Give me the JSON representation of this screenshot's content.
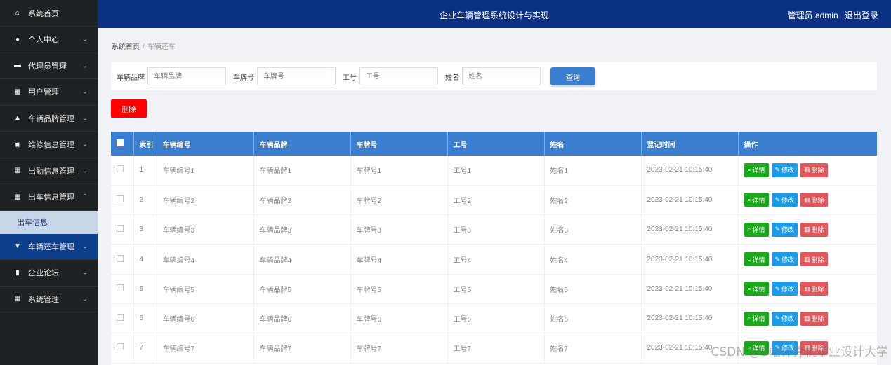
{
  "sidebar": {
    "items": [
      {
        "icon": "home-icon",
        "glyph": "⌂",
        "label": "系统首页",
        "chevron": ""
      },
      {
        "icon": "user-icon",
        "glyph": "●",
        "label": "个人中心",
        "chevron": "⌄"
      },
      {
        "icon": "monitor-icon",
        "glyph": "▬",
        "label": "代理员管理",
        "chevron": "⌄"
      },
      {
        "icon": "grid-icon",
        "glyph": "▦",
        "label": "用户管理",
        "chevron": "⌄"
      },
      {
        "icon": "car-icon",
        "glyph": "▲",
        "label": "车辆品牌管理",
        "chevron": "⌄"
      },
      {
        "icon": "clipboard-icon",
        "glyph": "▣",
        "label": "维修信息管理",
        "chevron": "⌄"
      },
      {
        "icon": "grid-icon",
        "glyph": "▦",
        "label": "出勤信息管理",
        "chevron": "⌄"
      },
      {
        "icon": "grid-icon",
        "glyph": "▦",
        "label": "出车信息管理",
        "chevron": "⌃"
      }
    ],
    "sub_item": "出车信息",
    "active_item": {
      "icon": "flag-icon",
      "glyph": "▼",
      "label": "车辆还车管理",
      "chevron": "⌄"
    },
    "after_items": [
      {
        "icon": "bar-chart-icon",
        "glyph": "▮",
        "label": "企业论坛",
        "chevron": "⌄"
      },
      {
        "icon": "grid-icon",
        "glyph": "▦",
        "label": "系统管理",
        "chevron": "⌄"
      }
    ]
  },
  "header": {
    "title": "企业车辆管理系统设计与实现",
    "user_prefix": "管理员 admin",
    "logout": "退出登录"
  },
  "breadcrumb": {
    "home": "系统首页",
    "sep": "/",
    "current": "车辆还车"
  },
  "filter": {
    "brand_label": "车辆品牌",
    "brand_placeholder": "车辆品牌",
    "plate_label": "车牌号",
    "plate_placeholder": "车牌号",
    "staff_label": "工号",
    "staff_placeholder": "工号",
    "name_label": "姓名",
    "name_placeholder": "姓名",
    "search_label": "查询"
  },
  "delete_label": "删除",
  "table": {
    "headers": [
      "索引",
      "车辆编号",
      "车辆品牌",
      "车牌号",
      "工号",
      "姓名",
      "登记时间",
      "操作"
    ],
    "rows": [
      {
        "index": "1",
        "code": "车辆编号1",
        "brand": "车辆品牌1",
        "plate": "车牌号1",
        "staff": "工号1",
        "name": "姓名1",
        "time": "2023-02-21 10:15:40"
      },
      {
        "index": "2",
        "code": "车辆编号2",
        "brand": "车辆品牌2",
        "plate": "车牌号2",
        "staff": "工号2",
        "name": "姓名2",
        "time": "2023-02-21 10:15:40"
      },
      {
        "index": "3",
        "code": "车辆编号3",
        "brand": "车辆品牌3",
        "plate": "车牌号3",
        "staff": "工号3",
        "name": "姓名3",
        "time": "2023-02-21 10:15:40"
      },
      {
        "index": "4",
        "code": "车辆编号4",
        "brand": "车辆品牌4",
        "plate": "车牌号4",
        "staff": "工号4",
        "name": "姓名4",
        "time": "2023-02-21 10:15:40"
      },
      {
        "index": "5",
        "code": "车辆编号5",
        "brand": "车辆品牌5",
        "plate": "车牌号5",
        "staff": "工号5",
        "name": "姓名5",
        "time": "2023-02-21 10:15:40"
      },
      {
        "index": "6",
        "code": "车辆编号6",
        "brand": "车辆品牌6",
        "plate": "车牌号6",
        "staff": "工号6",
        "name": "姓名6",
        "time": "2023-02-21 10:15:40"
      },
      {
        "index": "7",
        "code": "车辆编号7",
        "brand": "车辆品牌7",
        "plate": "车牌号7",
        "staff": "工号7",
        "name": "姓名7",
        "time": "2023-02-21 10:15:40"
      }
    ],
    "actions": {
      "detail": "详情",
      "edit": "修改",
      "delete": "删除"
    }
  },
  "watermark": "CSDN @B站计算机毕业设计大学",
  "colors": {
    "sidebar_bg": "#1f2224",
    "header_bg": "#0a3182",
    "table_head_bg": "#3a7ecf",
    "delete_red": "#ff0000",
    "detail_green": "#1ca81c",
    "edit_blue": "#1e9be8",
    "row_delete_red": "#e0565b"
  }
}
